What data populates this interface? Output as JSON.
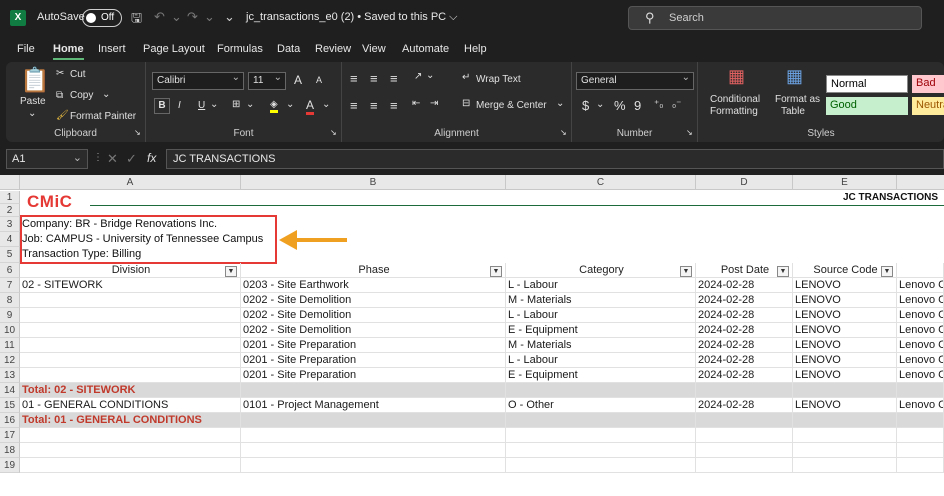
{
  "titlebar": {
    "app_icon": "X",
    "autosave_label": "AutoSave",
    "autosave_state": "Off",
    "doc_title": "jc_transactions_e0 (2) • Saved to this PC ⌵",
    "search_placeholder": "Search"
  },
  "menu_tabs": [
    "File",
    "Home",
    "Insert",
    "Page Layout",
    "Formulas",
    "Data",
    "Review",
    "View",
    "Automate",
    "Help"
  ],
  "active_tab": "Home",
  "ribbon": {
    "clipboard": {
      "paste": "Paste",
      "cut": "Cut",
      "copy": "Copy",
      "format_painter": "Format Painter",
      "label": "Clipboard"
    },
    "font": {
      "name": "Calibri",
      "size": "11",
      "bold": "B",
      "italic": "I",
      "underline": "U",
      "grow": "A",
      "shrink": "A",
      "label": "Font"
    },
    "alignment": {
      "wrap_text": "Wrap Text",
      "merge_center": "Merge & Center",
      "label": "Alignment"
    },
    "number": {
      "format": "General",
      "currency": "$",
      "percent": "%",
      "comma": "9",
      "label": "Number"
    },
    "styles": {
      "conditional": "Conditional",
      "formatting": "Formatting",
      "format_as": "Format as",
      "table": "Table",
      "normal": "Normal",
      "bad": "Bad",
      "good": "Good",
      "neutral": "Neutra",
      "label": "Styles"
    }
  },
  "formula_bar": {
    "name_box": "A1",
    "fx": "fx",
    "content": "JC TRANSACTIONS"
  },
  "columns": [
    "A",
    "B",
    "C",
    "D",
    "E"
  ],
  "rows": [
    "1",
    "2",
    "3",
    "4",
    "5",
    "6",
    "7",
    "8",
    "9",
    "10",
    "11",
    "12",
    "13",
    "14",
    "15",
    "16",
    "17",
    "18",
    "19"
  ],
  "sheet": {
    "logo": "CMiC",
    "report_title": "JC TRANSACTIONS",
    "info": [
      "Company: BR - Bridge Renovations Inc.",
      "Job: CAMPUS - University of Tennessee Campus",
      "Transaction Type: Billing"
    ],
    "headers": [
      "Division",
      "Phase",
      "Category",
      "Post Date",
      "Source Code",
      ""
    ],
    "data": [
      [
        "02 - SITEWORK",
        "0203 - Site Earthwork",
        "L - Labour",
        "2024-02-28",
        "LENOVO",
        "Lenovo C"
      ],
      [
        "",
        "0202 - Site Demolition",
        "M - Materials",
        "2024-02-28",
        "LENOVO",
        "Lenovo C"
      ],
      [
        "",
        "0202 - Site Demolition",
        "L - Labour",
        "2024-02-28",
        "LENOVO",
        "Lenovo C"
      ],
      [
        "",
        "0202 - Site Demolition",
        "E - Equipment",
        "2024-02-28",
        "LENOVO",
        "Lenovo C"
      ],
      [
        "",
        "0201 - Site Preparation",
        "M - Materials",
        "2024-02-28",
        "LENOVO",
        "Lenovo C"
      ],
      [
        "",
        "0201 - Site Preparation",
        "L - Labour",
        "2024-02-28",
        "LENOVO",
        "Lenovo C"
      ],
      [
        "",
        "0201 - Site Preparation",
        "E - Equipment",
        "2024-02-28",
        "LENOVO",
        "Lenovo C"
      ]
    ],
    "total_sitework": "Total: 02 - SITEWORK",
    "gc_row": [
      "01 - GENERAL CONDITIONS",
      "0101 - Project Management",
      "O - Other",
      "2024-02-28",
      "LENOVO",
      "Lenovo C"
    ],
    "total_gc": "Total: 01 - GENERAL CONDITIONS"
  },
  "colors": {
    "accent": "#107c41",
    "annotation": "#e53935",
    "arrow": "#f0a020",
    "total_text": "#c0392b"
  }
}
